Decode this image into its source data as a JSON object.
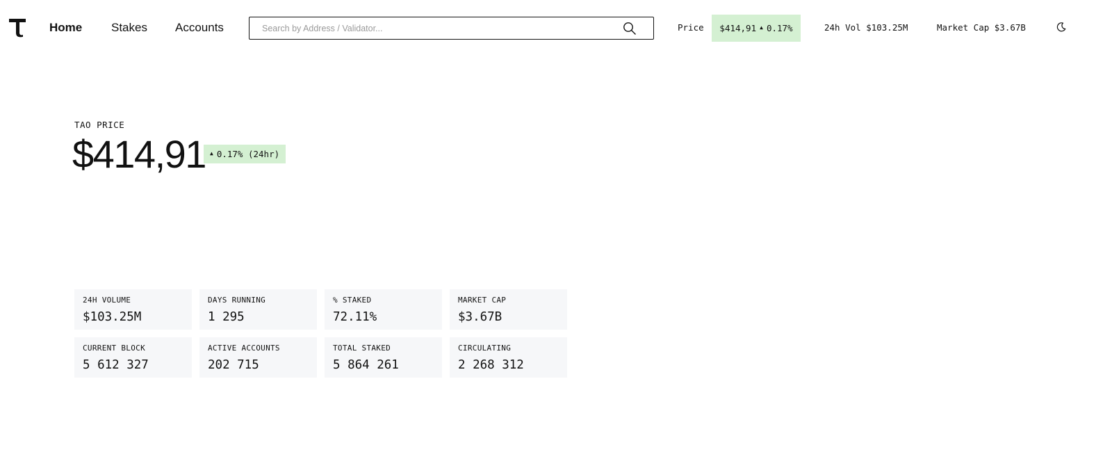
{
  "nav": {
    "logo_glyph": "T",
    "links": [
      "Home",
      "Stakes",
      "Accounts"
    ],
    "active": "Home"
  },
  "search": {
    "placeholder": "Search by Address / Validator...",
    "value": ""
  },
  "ticker": {
    "price_label": "Price",
    "price": "$414,91",
    "change": "0.17%",
    "volume": "24h Vol $103.25M",
    "market_cap": "Market Cap $3.67B"
  },
  "hero": {
    "label": "TAO PRICE",
    "price": "$414,91",
    "change": "0.17% (24hr)"
  },
  "stats": [
    {
      "label": "24H VOLUME",
      "value": "$103.25M"
    },
    {
      "label": "DAYS RUNNING",
      "value": "1 295"
    },
    {
      "label": "% STAKED",
      "value": "72.11%"
    },
    {
      "label": "MARKET CAP",
      "value": "$3.67B"
    },
    {
      "label": "CURRENT BLOCK",
      "value": "5 612 327"
    },
    {
      "label": "ACTIVE ACCOUNTS",
      "value": "202 715"
    },
    {
      "label": "TOTAL STAKED",
      "value": "5 864 261"
    },
    {
      "label": "CIRCULATING",
      "value": "2 268 312"
    }
  ],
  "colors": {
    "positive_bg": "#d4f0d2",
    "card_bg": "#f6f7f9",
    "text": "#111111"
  },
  "icons": {
    "logo": "tao-logo-icon",
    "search": "search-icon",
    "theme": "moon-icon",
    "up": "caret-up-icon"
  }
}
